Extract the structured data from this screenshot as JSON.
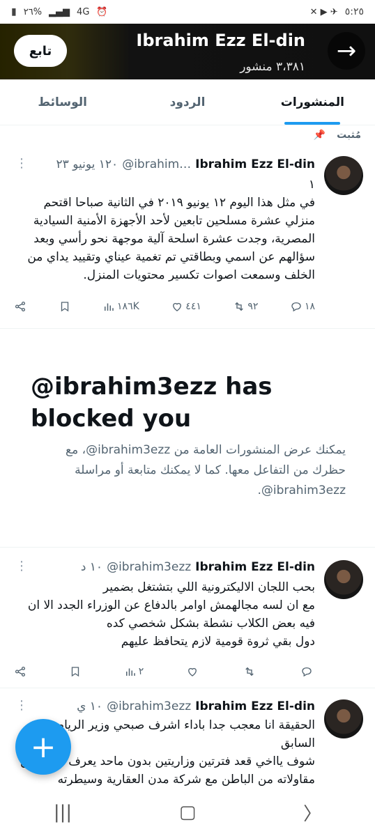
{
  "status_bar": {
    "time": "٥:٢٥",
    "battery": "٢٦%",
    "network": "4G"
  },
  "header": {
    "name": "Ibrahim Ezz El-din",
    "post_count": "٣،٣٨١ منشور",
    "follow_label": "تابع"
  },
  "tabs": [
    {
      "label": "المنشورات",
      "active": true
    },
    {
      "label": "الردود",
      "active": false
    },
    {
      "label": "الوسائط",
      "active": false
    }
  ],
  "pinned_label": "مُثبت",
  "tweets": [
    {
      "name": "Ibrahim Ezz El-din",
      "handle": "@ibrahim…",
      "time": "١٢٠ يونيو ٢٣",
      "body": "١\nفي مثل هذا اليوم ١٢ يونيو ٢٠١٩ في الثانية صباحا اقتحم منزلي عشرة مسلحين تابعين لأحد الأجهزة الأمنية السيادية المصرية، وجدت عشرة اسلحة آلية موجهة نحو رأسي وبعد سؤالهم عن اسمي وبطاقتي تم تغمية عيناي وتقييد يداي من الخلف وسمعت اصوات تكسير محتويات المنزل.",
      "replies": "١٨",
      "reposts": "٩٢",
      "likes": "٤٤١",
      "views": "١٨٦K"
    },
    {
      "name": "Ibrahim Ezz El-din",
      "handle": "@ibrahim3ezz",
      "time": "١٠ د",
      "body": "بحب اللجان الاليكترونية اللي بتشتغل بضمير\nمع ان لسه مجالهمش اوامر بالدفاع عن الوزراء الجدد الا ان فيه بعض الكلاب نشطة بشكل شخصي كده\nدول بقي ثروة قومية لازم يتحافظ عليهم",
      "replies": "",
      "reposts": "",
      "likes": "",
      "views": "٢"
    },
    {
      "name": "Ibrahim Ezz El-din",
      "handle": "@ibrahim3ezz",
      "time": "١٠ ي",
      "body": "الحقيقة انا معجب جدا باداء اشرف صبحي وزير الرياضة السابق\nشوف يااخي قعد فترتين وزاريتين بدون ماحد يعرف حاجة عن مقاولاته من الباطن مع شركة مدن العقارية وسيطرته",
      "replies": "",
      "reposts": "",
      "likes": "",
      "views": ""
    }
  ],
  "blocked": {
    "title": "@ibrahim3ezz has blocked you",
    "text": "يمكنك عرض المنشورات العامة من ‎@ibrahim3ezz، مع حظرك من التفاعل معها. كما لا يمكنك متابعة أو مراسلة ‎@ibrahim3ezz."
  },
  "fab_label": "+",
  "colors": {
    "accent": "#1d9bf0",
    "text": "#0f1419",
    "muted": "#536471"
  }
}
